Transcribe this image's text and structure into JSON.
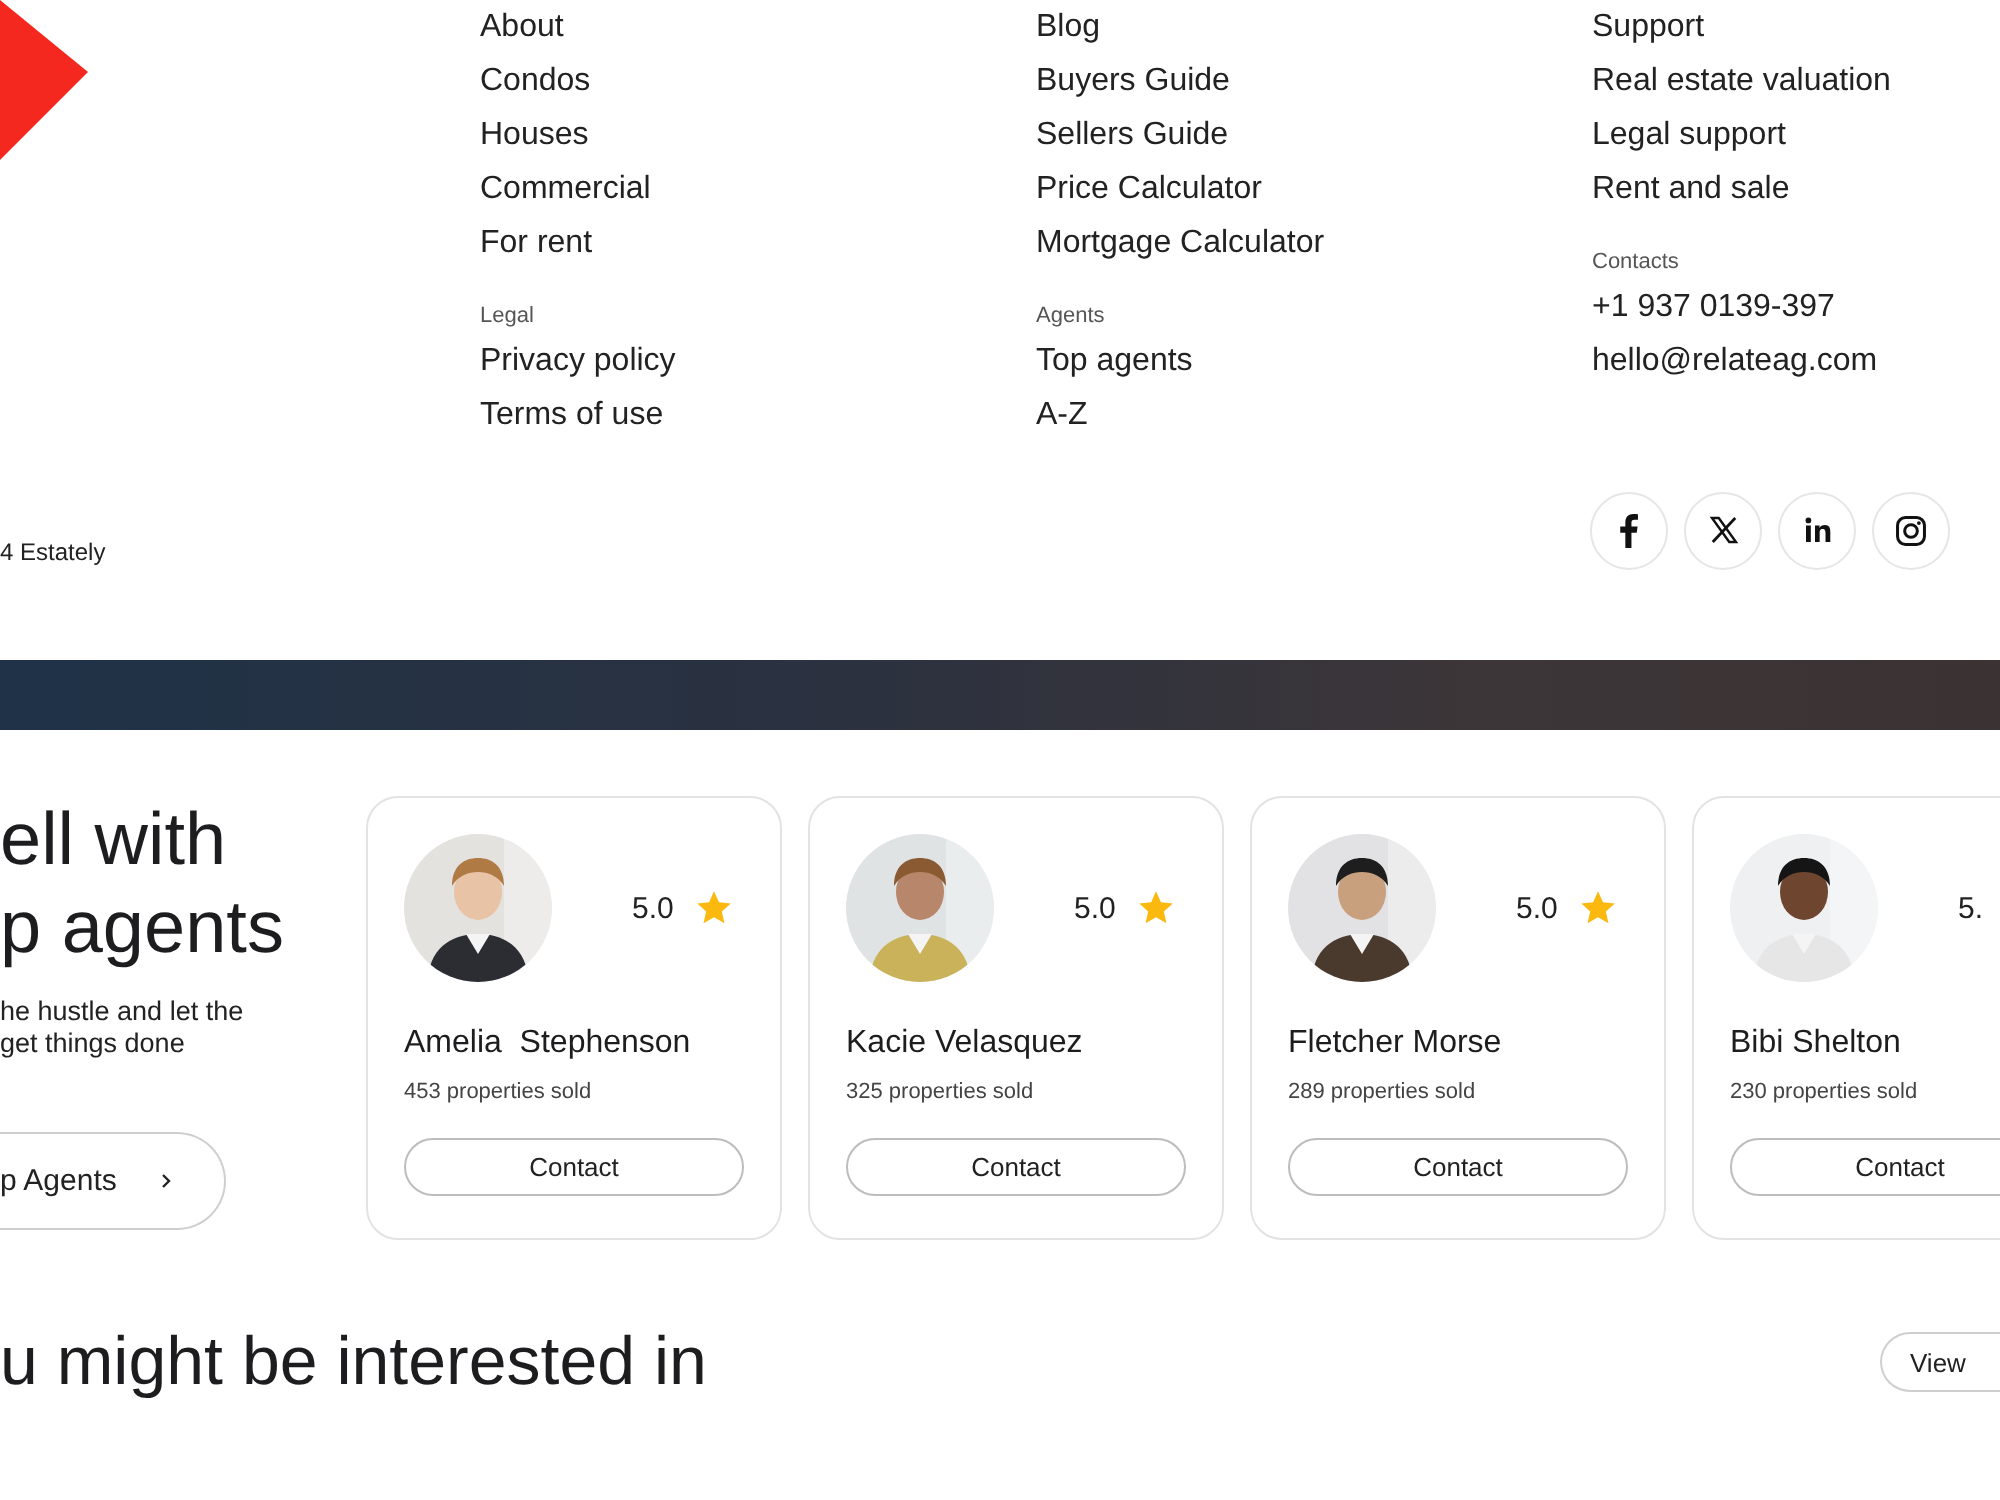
{
  "footer": {
    "columns": [
      {
        "sections": [
          {
            "links": [
              "About",
              "Condos",
              "Houses",
              "Commercial",
              "For rent"
            ]
          },
          {
            "heading": "Legal",
            "links": [
              "Privacy policy",
              "Terms of use"
            ]
          }
        ]
      },
      {
        "sections": [
          {
            "links": [
              "Blog",
              "Buyers Guide",
              "Sellers Guide",
              "Price Calculator",
              "Mortgage Calculator"
            ]
          },
          {
            "heading": "Agents",
            "links": [
              "Top agents",
              "A-Z"
            ]
          }
        ]
      },
      {
        "sections": [
          {
            "links": [
              "Support",
              "Real estate valuation",
              "Legal support",
              "Rent and sale"
            ]
          },
          {
            "heading": "Contacts",
            "links": [
              "+1 937 0139-397",
              "hello@relateag.com"
            ]
          }
        ]
      }
    ],
    "copyright": "4 Estately",
    "social": [
      {
        "kind": "facebook"
      },
      {
        "kind": "x"
      },
      {
        "kind": "linkedin"
      },
      {
        "kind": "instagram"
      }
    ]
  },
  "agents_section": {
    "title_lines": [
      "ell with",
      "p agents"
    ],
    "description_lines": [
      "he hustle and let the",
      "get things done"
    ],
    "button": "p Agents",
    "agents": [
      {
        "name": "Amelia  Stephenson",
        "rating": "5.0",
        "star_shown": true,
        "sold": "453 properties sold",
        "contact": "Contact"
      },
      {
        "name": "Kacie Velasquez",
        "rating": "5.0",
        "star_shown": true,
        "sold": "325 properties sold",
        "contact": "Contact"
      },
      {
        "name": "Fletcher Morse",
        "rating": "5.0",
        "star_shown": true,
        "sold": "289 properties sold",
        "contact": "Contact"
      },
      {
        "name": "Bibi Shelton",
        "rating": "5.",
        "star_shown": false,
        "sold": "230 properties sold",
        "contact": "Contact"
      }
    ]
  },
  "interested": {
    "title": "u might be interested in",
    "button": "View"
  }
}
